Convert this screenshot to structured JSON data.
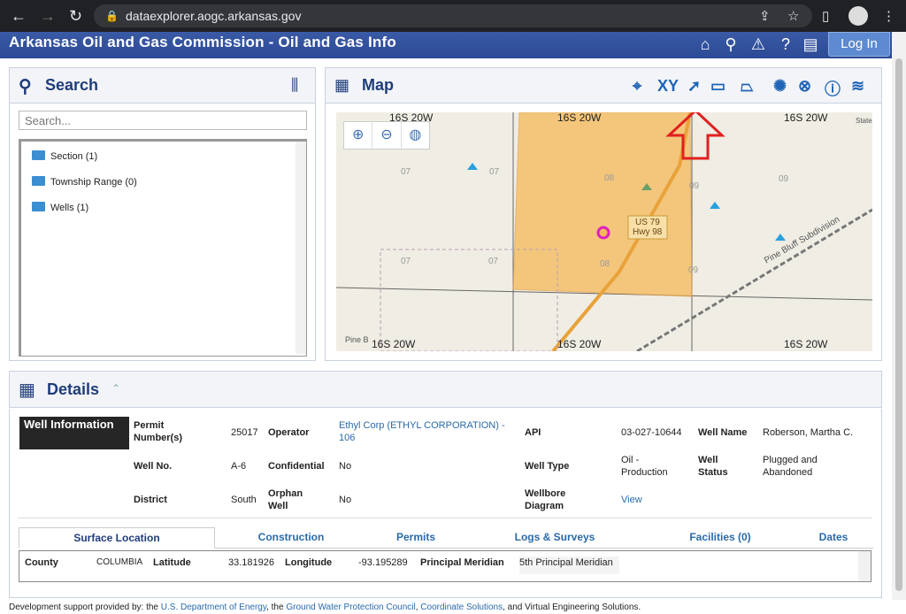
{
  "browser": {
    "url": "dataexplorer.aogc.arkansas.gov"
  },
  "app": {
    "title": "Arkansas Oil and Gas Commission - Oil and Gas Info",
    "login_label": "Log In"
  },
  "search": {
    "title": "Search",
    "placeholder": "Search...",
    "items": [
      {
        "label": "Section (1)"
      },
      {
        "label": "Township Range (0)"
      },
      {
        "label": "Wells (1)"
      }
    ]
  },
  "map": {
    "title": "Map",
    "xy_label": "XY",
    "labels": {
      "tl": "16S 20W",
      "tc": "16S 20W",
      "tr": "16S 20W",
      "bl": "16S 20W",
      "bc": "16S 20W",
      "br": "16S 20W",
      "hwy1": "US 79",
      "hwy2": "Hwy 98",
      "road": "Pine Bluff Subdivision",
      "state": "State",
      "pine": "Pine B"
    },
    "sections": [
      "07",
      "07",
      "08",
      "09",
      "09",
      "07",
      "07",
      "08",
      "09"
    ]
  },
  "details": {
    "title": "Details",
    "well_info_label": "Well Information",
    "fields": {
      "permit_k": "Permit Number(s)",
      "permit_v": "25017",
      "operator_k": "Operator",
      "operator_v": "Ethyl Corp (ETHYL CORPORATION) - 106",
      "api_k": "API",
      "api_v": "03-027-10644",
      "wellname_k": "Well Name",
      "wellname_v": "Roberson, Martha C.",
      "wellno_k": "Well No.",
      "wellno_v": "A-6",
      "conf_k": "Confidential",
      "conf_v": "No",
      "type_k": "Well Type",
      "type_v": "Oil - Production",
      "status_k": "Well Status",
      "status_v": "Plugged and Abandoned",
      "district_k": "District",
      "district_v": "South",
      "orphan_k": "Orphan Well",
      "orphan_v": "No",
      "diagram_k": "Wellbore Diagram",
      "diagram_v": "View"
    },
    "tabs": [
      {
        "label": "Surface Location"
      },
      {
        "label": "Construction"
      },
      {
        "label": "Permits"
      },
      {
        "label": "Logs & Surveys"
      },
      {
        "label": "Facilities (0)"
      },
      {
        "label": "Dates"
      }
    ],
    "table": {
      "county_k": "County",
      "county_v": "COLUMBIA",
      "lat_k": "Latitude",
      "lat_v": "33.181926",
      "lon_k": "Longitude",
      "lon_v": "-93.195289",
      "pm_k": "Principal Meridian",
      "pm_v": "5th Principal Meridian"
    }
  },
  "footer": {
    "prefix": "Development support provided by: the ",
    "l1": "U.S. Department of Energy",
    "s1": ", the ",
    "l2": "Ground Water Protection Council",
    "s2": ", ",
    "l3": "Coordinate Solutions",
    "suffix": ", and Virtual Engineering Solutions."
  },
  "colors": {
    "brand": "#2c4a96",
    "accent": "#1f64b6",
    "selection": "#f5b95a",
    "well": "#e020c0",
    "annotation": "#e02020"
  }
}
